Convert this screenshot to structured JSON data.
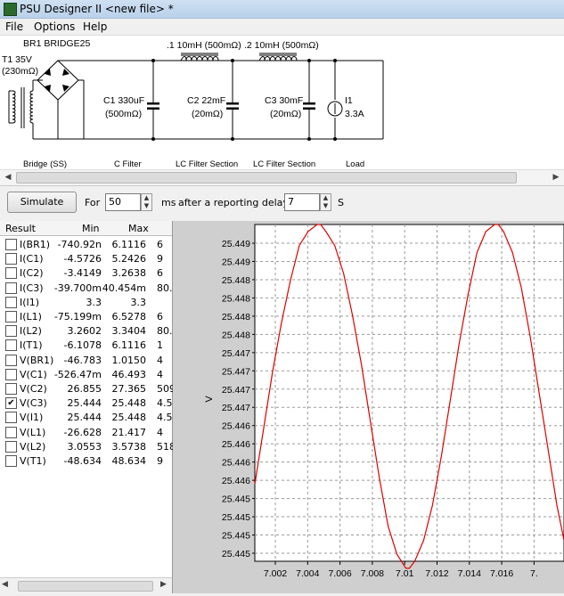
{
  "window": {
    "title": "PSU Designer II  <new file> *"
  },
  "menu": [
    "File",
    "Options",
    "Help"
  ],
  "schematic": {
    "transformer": {
      "name": "T1 35V",
      "resistance": "(230mΩ)"
    },
    "rectifier": "BR1 BRIDGE25",
    "l1": ".1 10mH (500mΩ)",
    "l2": ".2 10mH (500mΩ)",
    "c1": {
      "name": "C1 330uF",
      "res": "(500mΩ)"
    },
    "c2": {
      "name": "C2 22mF",
      "res": "(20mΩ)"
    },
    "c3": {
      "name": "C3 30mF",
      "res": "(20mΩ)"
    },
    "load": {
      "name": "I1",
      "value": "3.3A"
    },
    "sections": [
      "Bridge (SS)",
      "C Filter",
      "LC Filter Section",
      "LC Filter Section",
      "Load"
    ]
  },
  "controls": {
    "simulate": "Simulate",
    "for_label": "For",
    "for_value": "50",
    "ms": "ms",
    "after": "after a reporting delay of",
    "delay_value": "7",
    "s": "S"
  },
  "results": {
    "headers": [
      "Result",
      "Min",
      "Max"
    ],
    "rows": [
      {
        "name": "I(BR1)",
        "min": "-740.92n",
        "max": "6.1116",
        "extra": "6",
        "checked": false
      },
      {
        "name": "I(C1)",
        "min": "-4.5726",
        "max": "5.2426",
        "extra": "9",
        "checked": false
      },
      {
        "name": "I(C2)",
        "min": "-3.4149",
        "max": "3.2638",
        "extra": "6",
        "checked": false
      },
      {
        "name": "I(C3)",
        "min": "-39.700m",
        "max": "40.454m",
        "extra": "80.",
        "checked": false
      },
      {
        "name": "I(I1)",
        "min": "3.3",
        "max": "3.3",
        "extra": "",
        "checked": false
      },
      {
        "name": "I(L1)",
        "min": "-75.199m",
        "max": "6.5278",
        "extra": "6",
        "checked": false
      },
      {
        "name": "I(L2)",
        "min": "3.2602",
        "max": "3.3404",
        "extra": "80.",
        "checked": false
      },
      {
        "name": "I(T1)",
        "min": "-6.1078",
        "max": "6.1116",
        "extra": "1",
        "checked": false
      },
      {
        "name": "V(BR1)",
        "min": "-46.783",
        "max": "1.0150",
        "extra": "4",
        "checked": false
      },
      {
        "name": "V(C1)",
        "min": "-526.47m",
        "max": "46.493",
        "extra": "4",
        "checked": false
      },
      {
        "name": "V(C2)",
        "min": "26.855",
        "max": "27.365",
        "extra": "509",
        "checked": false
      },
      {
        "name": "V(C3)",
        "min": "25.444",
        "max": "25.448",
        "extra": "4.5",
        "checked": true
      },
      {
        "name": "V(I1)",
        "min": "25.444",
        "max": "25.448",
        "extra": "4.5",
        "checked": false
      },
      {
        "name": "V(L1)",
        "min": "-26.628",
        "max": "21.417",
        "extra": "4",
        "checked": false
      },
      {
        "name": "V(L2)",
        "min": "3.0553",
        "max": "3.5738",
        "extra": "518",
        "checked": false
      },
      {
        "name": "V(T1)",
        "min": "-48.634",
        "max": "48.634",
        "extra": "9",
        "checked": false
      }
    ]
  },
  "chart_data": {
    "type": "line",
    "ylabel": "V",
    "ytick_labels": [
      "25.449",
      "25.449",
      "25.448",
      "25.448",
      "25.448",
      "25.448",
      "25.447",
      "25.447",
      "25.447",
      "25.447",
      "25.446",
      "25.446",
      "25.446",
      "25.446",
      "25.445",
      "25.445",
      "25.445",
      "25.445"
    ],
    "xticks": [
      "7.002",
      "7.004",
      "7.006",
      "7.008",
      "7.01",
      "7.012",
      "7.014",
      "7.016",
      "7."
    ],
    "xlim": [
      7.0,
      7.0174
    ],
    "ylim": [
      25.4446,
      25.4494
    ],
    "series": [
      {
        "color": "#e00000",
        "x": [
          7.0,
          7.0005,
          7.001,
          7.0015,
          7.002,
          7.0025,
          7.003,
          7.0035,
          7.0037,
          7.004,
          7.0045,
          7.005,
          7.0055,
          7.006,
          7.0065,
          7.007,
          7.0075,
          7.008,
          7.0085,
          7.0087,
          7.009,
          7.0095,
          7.01,
          7.0105,
          7.011,
          7.0115,
          7.012,
          7.0125,
          7.013,
          7.0135,
          7.0137,
          7.014,
          7.0145,
          7.015,
          7.0155,
          7.016,
          7.0165,
          7.017,
          7.0174
        ],
        "y": [
          25.4457,
          25.4465,
          25.4473,
          25.448,
          25.4486,
          25.4491,
          25.4493,
          25.4494,
          25.4494,
          25.4493,
          25.4491,
          25.4487,
          25.4481,
          25.4474,
          25.4466,
          25.4458,
          25.4451,
          25.4447,
          25.4445,
          25.4445,
          25.4446,
          25.4449,
          25.4454,
          25.4461,
          25.4469,
          25.4477,
          25.4484,
          25.449,
          25.4493,
          25.4494,
          25.4494,
          25.4493,
          25.449,
          25.4485,
          25.4478,
          25.447,
          25.4462,
          25.4454,
          25.4449
        ]
      }
    ]
  },
  "colors": {
    "curve": "#e00000",
    "plot_bg": "#ffffff",
    "frame_bg": "#cfcfcf"
  }
}
